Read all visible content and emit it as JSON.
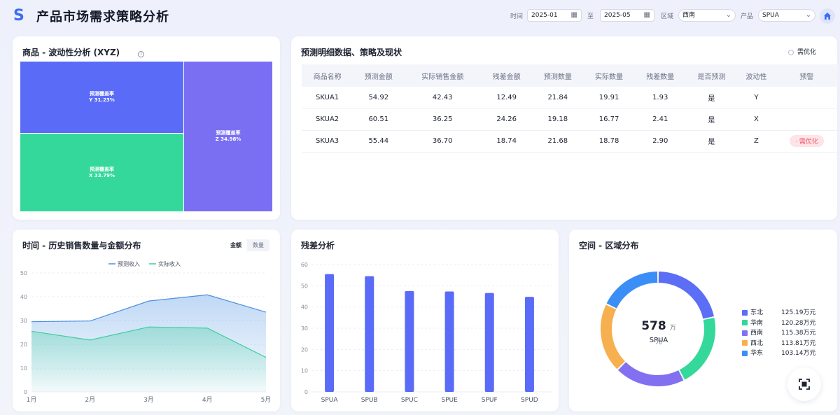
{
  "app": {
    "title": "产品市场需求策略分析",
    "logo_glyph": "S"
  },
  "filters": {
    "time_label": "时间",
    "start": "2025-01",
    "to_label": "至",
    "end": "2025-05",
    "region_label": "区域",
    "region": "西南",
    "product_label": "产品",
    "product": "SPUA"
  },
  "xyz": {
    "title": "商品 - 波动性分析 (XYZ)",
    "cells": [
      {
        "label": "预测覆盖率",
        "value": "Y 31.23%",
        "color": "#5a6bf7"
      },
      {
        "label": "预测覆盖率",
        "value": "X 33.79%",
        "color": "#34d89a"
      },
      {
        "label": "预测覆盖率",
        "value": "Z 34.98%",
        "color": "#7a6ff3"
      }
    ]
  },
  "forecast_table": {
    "title": "预测明细数据、策略及现状",
    "filter_label": "需优化",
    "columns": [
      "商品名称",
      "预测金额",
      "实际销售金额",
      "残差金额",
      "预测数量",
      "实际数量",
      "残差数量",
      "是否预测",
      "波动性",
      "预警"
    ],
    "rows": [
      [
        "SKUA1",
        "54.92",
        "42.43",
        "12.49",
        "21.84",
        "19.91",
        "1.93",
        "是",
        "Y",
        ""
      ],
      [
        "SKUA2",
        "60.51",
        "36.25",
        "24.26",
        "19.18",
        "16.77",
        "2.41",
        "是",
        "X",
        ""
      ],
      [
        "SKUA3",
        "55.44",
        "36.70",
        "18.74",
        "21.68",
        "18.78",
        "2.90",
        "是",
        "Z",
        "需优化"
      ]
    ]
  },
  "history": {
    "title": "时间 - 历史销售数量与金额分布",
    "tabs": [
      "金额",
      "数量"
    ],
    "active_tab": "金额"
  },
  "residual": {
    "title": "残差分析"
  },
  "region": {
    "title": "空间 - 区域分布",
    "center_value": "578",
    "center_unit": "万元",
    "center_label": "SPUA",
    "legend": [
      {
        "name": "东北",
        "value": "125.19万元",
        "color": "#5b6ef5"
      },
      {
        "name": "华南",
        "value": "120.28万元",
        "color": "#34d89a"
      },
      {
        "name": "西南",
        "value": "115.38万元",
        "color": "#8270f0"
      },
      {
        "name": "西北",
        "value": "113.81万元",
        "color": "#f7b04f"
      },
      {
        "name": "华东",
        "value": "103.14万元",
        "color": "#3c8ef7"
      }
    ]
  },
  "chart_data": [
    {
      "type": "area",
      "x": [
        "1月",
        "2月",
        "3月",
        "4月",
        "5月"
      ],
      "ylim": [
        0,
        50
      ],
      "yticks": [
        0,
        10,
        20,
        30,
        40,
        50
      ],
      "legend_position": "top",
      "series": [
        {
          "name": "预测收入",
          "values": [
            29.5,
            29.8,
            38.2,
            40.8,
            33.5
          ],
          "color": "#4a90e2"
        },
        {
          "name": "实际收入",
          "values": [
            25.5,
            21.8,
            27.3,
            26.8,
            14.5
          ],
          "color": "#3ccda0"
        }
      ]
    },
    {
      "type": "bar",
      "categories": [
        "SPUA",
        "SPUB",
        "SPUC",
        "SPUE",
        "SPUF",
        "SPUD"
      ],
      "values": [
        55.5,
        54.5,
        47.5,
        47.3,
        46.6,
        44.8
      ],
      "ylim": [
        0,
        60
      ],
      "yticks": [
        0,
        10,
        20,
        30,
        40,
        50,
        60
      ],
      "color": "#5a6bf7"
    },
    {
      "type": "pie",
      "categories": [
        "东北",
        "华南",
        "西南",
        "西北",
        "华东"
      ],
      "values": [
        125.19,
        120.28,
        115.38,
        113.81,
        103.14
      ],
      "colors": [
        "#5b6ef5",
        "#34d89a",
        "#8270f0",
        "#f7b04f",
        "#3c8ef7"
      ]
    }
  ]
}
